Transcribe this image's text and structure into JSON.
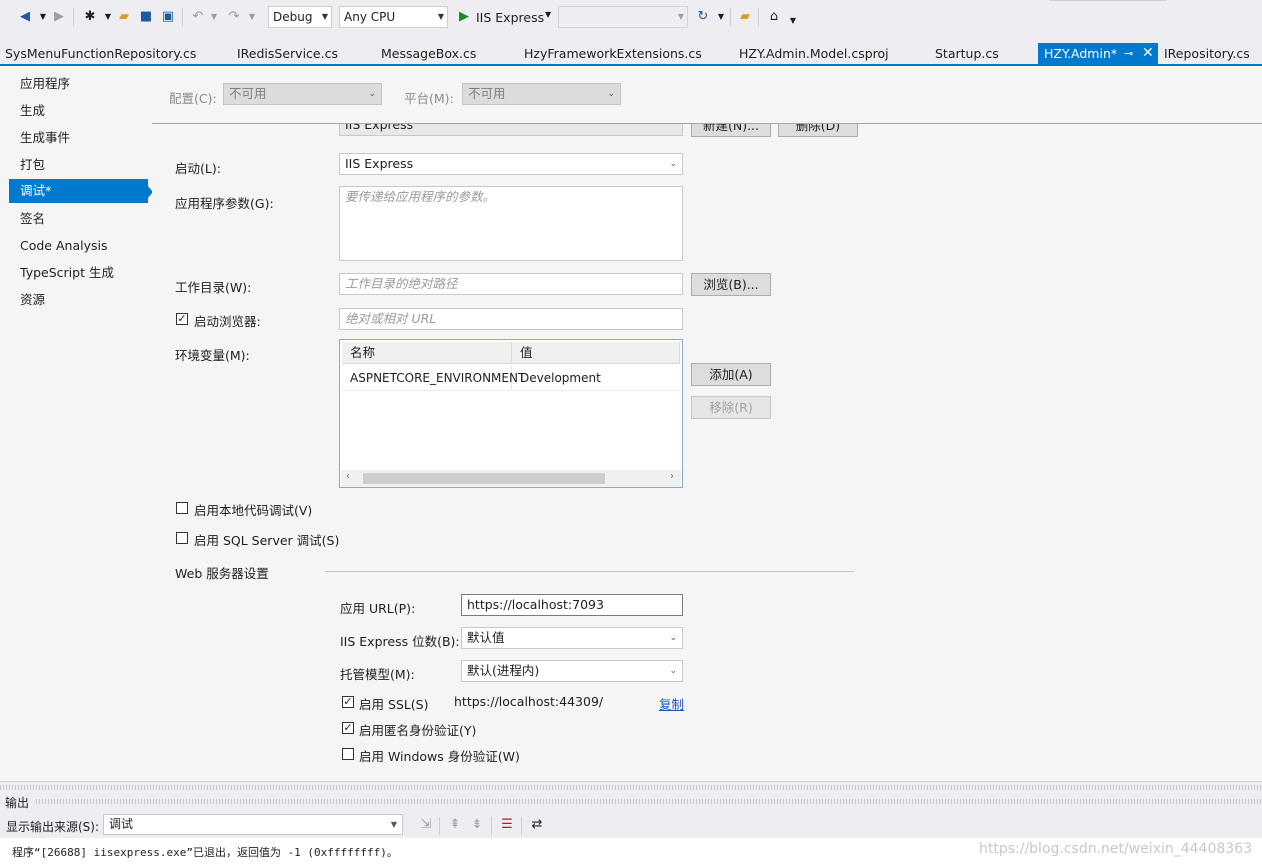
{
  "toolbar": {
    "config": "Debug",
    "platform": "Any CPU",
    "run_label": "IIS Express"
  },
  "tabs": [
    "SysMenuFunctionRepository.cs",
    "IRedisService.cs",
    "MessageBox.cs",
    "HzyFrameworkExtensions.cs",
    "HZY.Admin.Model.csproj",
    "Startup.cs",
    "HZY.Admin*",
    "IRepository.cs"
  ],
  "nav": {
    "items": [
      "应用程序",
      "生成",
      "生成事件",
      "打包",
      "调试*",
      "签名",
      "Code Analysis",
      "TypeScript 生成",
      "资源"
    ]
  },
  "header": {
    "config_label": "配置(C):",
    "config_value": "不可用",
    "platform_label": "平台(M):",
    "platform_value": "不可用"
  },
  "debug": {
    "profile_value": "IIS Express",
    "new_button": "新建(N)...",
    "delete_button": "删除(D)",
    "launch_label": "启动(L):",
    "launch_value": "IIS Express",
    "args_label": "应用程序参数(G):",
    "args_placeholder": "要传递给应用程序的参数。",
    "workdir_label": "工作目录(W):",
    "workdir_placeholder": "工作目录的绝对路径",
    "browse_button": "浏览(B)...",
    "launch_browser_label": "启动浏览器:",
    "url_placeholder": "绝对或相对 URL",
    "env_label": "环境变量(M):",
    "env_columns": [
      "名称",
      "值"
    ],
    "env_rows": [
      [
        "ASPNETCORE_ENVIRONMENT",
        "Development"
      ]
    ],
    "add_button": "添加(A)",
    "remove_button": "移除(R)",
    "native_debug_label": "启用本地代码调试(V)",
    "sql_debug_label": "启用 SQL Server 调试(S)"
  },
  "web": {
    "section_title": "Web 服务器设置",
    "app_url_label": "应用 URL(P):",
    "app_url_value": "https://localhost:7093",
    "bitness_label": "IIS Express 位数(B):",
    "bitness_value": "默认值",
    "hosting_label": "托管模型(M):",
    "hosting_value": "默认(进程内)",
    "ssl_label": "启用 SSL(S)",
    "ssl_url": "https://localhost:44309/",
    "copy_link": "复制",
    "anon_label": "启用匿名身份验证(Y)",
    "windows_label": "启用 Windows 身份验证(W)"
  },
  "output": {
    "title": "输出",
    "source_label": "显示输出来源(S):",
    "source_value": "调试",
    "message": "程序“[26688] iisexpress.exe”已退出，返回值为 -1 (0xffffffff)。",
    "watermark": "https://blog.csdn.net/weixin_44408363"
  },
  "colors": {
    "accent": "#007acc",
    "link": "#1a55b8"
  }
}
